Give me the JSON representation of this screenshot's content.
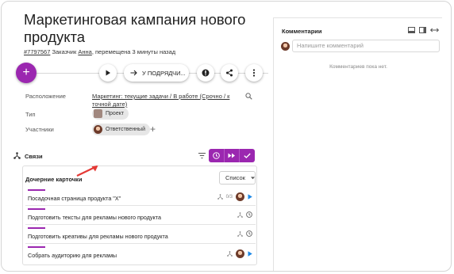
{
  "card": {
    "title": "Маркетинговая кампания нового продукта",
    "id_link": "#7797567",
    "meta_prefix": " Заказчик ",
    "customer": "Анна",
    "meta_suffix": ", перемещена 3 минуты назад"
  },
  "toolbar": {
    "add_label": "+",
    "move_label": "У ПОДРЯДЧИ..."
  },
  "fields": {
    "location_label": "Расположение",
    "location_value": "Маркетинг: текущие задачи / В работе (Срочно / к точной дате)",
    "type_label": "Тип",
    "type_value": "Проект",
    "participants_label": "Участники",
    "participant_role": "Ответственный"
  },
  "links": {
    "title": "Связи",
    "children_title": "Дочерние карточки",
    "view_select": "Список",
    "items": [
      {
        "text": "Посадочная страница продукта \"X\"",
        "subcount": "0/3",
        "has_avatar": true
      },
      {
        "text": "Подготовить тексты для рекламы нового продукта",
        "subcount": "",
        "has_avatar": false
      },
      {
        "text": "Подготовить креативы для рекламы нового продукта",
        "subcount": "",
        "has_avatar": false
      },
      {
        "text": "Собрать аудиторию для рекламы",
        "subcount": "",
        "has_avatar": true
      }
    ]
  },
  "comments": {
    "title": "Комментарии",
    "placeholder": "Напишите комментарий",
    "empty": "Комментариев пока нет."
  },
  "colors": {
    "accent": "#9b27b0",
    "play_blue": "#1e88e5",
    "arrow_red": "#e53935"
  }
}
